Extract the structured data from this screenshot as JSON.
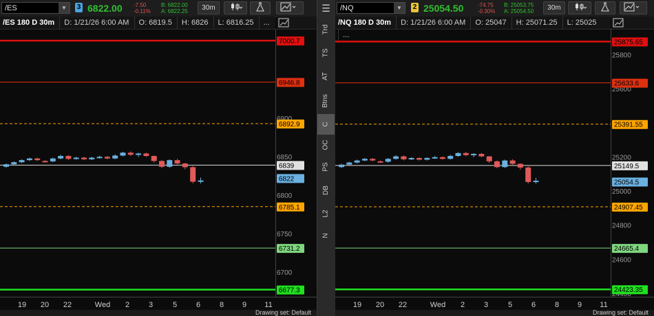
{
  "left": {
    "symbol": "/ES",
    "link": "3",
    "link_color": "#4aa3df",
    "last": "6822.00",
    "net_change": "-7.50",
    "net_pct": "-0.11%",
    "bid": "B: 6822.00",
    "ask": "A: 6822.25",
    "interval": "30m",
    "info": {
      "title": "/ES 180 D 30m",
      "date": "D: 1/21/26 6:00 AM",
      "open": "O: 6819.5",
      "high": "H: 6826",
      "low": "L: 6816.25",
      "more": "..."
    },
    "levels": [
      {
        "label": "7000.7",
        "value": 7000.7,
        "color": "#e01010",
        "style": "solid",
        "thick": true
      },
      {
        "label": "6946.8",
        "value": 6946.8,
        "color": "#e03010",
        "style": "solid",
        "thick": false
      },
      {
        "label": "6892.9",
        "value": 6892.9,
        "color": "#ffa500",
        "style": "dashed",
        "thick": false
      },
      {
        "label": "6839",
        "value": 6839,
        "color": "#e0e0e0",
        "style": "solid",
        "thick": false
      },
      {
        "label": "6785.1",
        "value": 6785.1,
        "color": "#ffa500",
        "style": "dashed",
        "thick": false
      },
      {
        "label": "6731.2",
        "value": 6731.2,
        "color": "#7fd67f",
        "style": "solid",
        "thick": false
      },
      {
        "label": "6677.3",
        "value": 6677.3,
        "color": "#20e020",
        "style": "solid",
        "thick": true
      }
    ],
    "price_tag": {
      "label": "6822",
      "value": 6822,
      "color": "#6ab0e0"
    },
    "yticks": [
      "6900",
      "6850",
      "6800",
      "6750",
      "6700"
    ],
    "ytick_values": [
      6900,
      6850,
      6800,
      6750,
      6700
    ],
    "ylim": [
      6668,
      7016
    ]
  },
  "right": {
    "symbol": "/NQ",
    "link": "2",
    "link_color": "#e8c43a",
    "last": "25054.50",
    "net_change": "-74.75",
    "net_pct": "-0.30%",
    "bid": "B: 25053.75",
    "ask": "A: 25054.50",
    "interval": "30m",
    "info": {
      "title": "/NQ 180 D 30m",
      "date": "D: 1/21/26 6:00 AM",
      "open": "O: 25047",
      "high": "H: 25071.25",
      "low": "L: 25025",
      "more": "..."
    },
    "levels": [
      {
        "label": "25875.65",
        "value": 25875.65,
        "color": "#e01010",
        "style": "solid",
        "thick": true
      },
      {
        "label": "25633.6",
        "value": 25633.6,
        "color": "#e03010",
        "style": "solid",
        "thick": false
      },
      {
        "label": "25391.55",
        "value": 25391.55,
        "color": "#ffa500",
        "style": "dashed",
        "thick": false
      },
      {
        "label": "25149.5",
        "value": 25149.5,
        "color": "#e0e0e0",
        "style": "solid",
        "thick": false
      },
      {
        "label": "24907.45",
        "value": 24907.45,
        "color": "#ffa500",
        "style": "dashed",
        "thick": false
      },
      {
        "label": "24665.4",
        "value": 24665.4,
        "color": "#7fd67f",
        "style": "solid",
        "thick": false
      },
      {
        "label": "24423.35",
        "value": 24423.35,
        "color": "#20e020",
        "style": "solid",
        "thick": true
      }
    ],
    "price_tag": {
      "label": "25054.5",
      "value": 25054.5,
      "color": "#6ab0e0"
    },
    "yticks": [
      "25800",
      "25600",
      "25400",
      "25200",
      "25000",
      "24800",
      "24600",
      "24400"
    ],
    "ytick_values": [
      25800,
      25600,
      25400,
      25200,
      25000,
      24800,
      24600,
      24400
    ],
    "ylim": [
      24380,
      25950
    ]
  },
  "xticks": [
    "19",
    "20",
    "22",
    "Wed",
    "2",
    "3",
    "5",
    "6",
    "8",
    "9",
    "11"
  ],
  "sidebar": [
    "Trd",
    "TS",
    "AT",
    "Btns",
    "C",
    "OC",
    "PS",
    "DB",
    "L2",
    "N"
  ],
  "sidebar_active": "C",
  "bottombar": "Drawing set: Default",
  "colors": {
    "up": "#6ab0e0",
    "down": "#e05a5a",
    "price_up": "#30c030",
    "price_down": "#e05050"
  }
}
